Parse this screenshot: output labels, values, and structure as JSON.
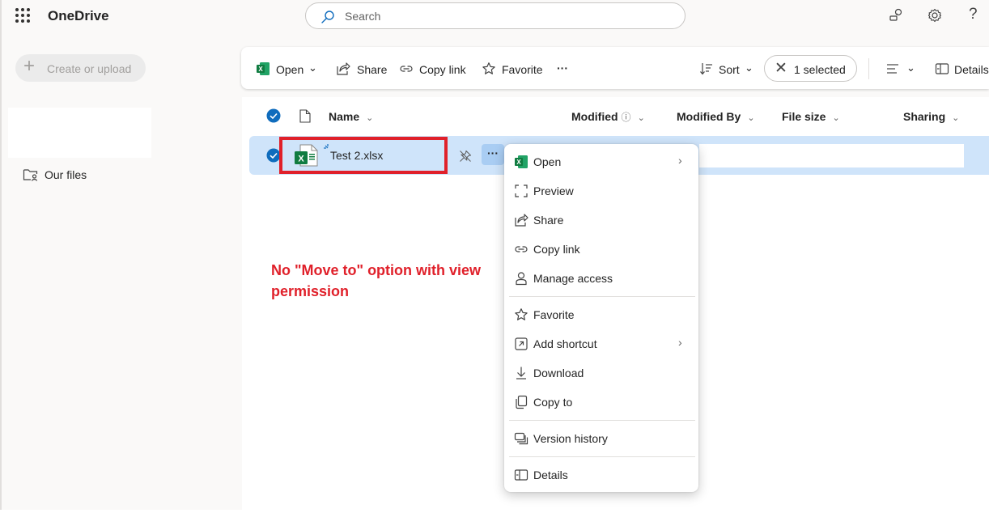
{
  "app": {
    "title": "OneDrive"
  },
  "search": {
    "placeholder": "Search"
  },
  "nav": {
    "create_label": "Create or upload",
    "items": [
      {
        "label": "Our files",
        "icon": "folder-person-icon"
      }
    ]
  },
  "commandbar": {
    "open": "Open",
    "share": "Share",
    "copy_link": "Copy link",
    "favorite": "Favorite",
    "more": "···",
    "sort": "Sort",
    "selected": "1 selected",
    "details": "Details"
  },
  "columns": {
    "name": "Name",
    "modified": "Modified",
    "modified_by": "Modified By",
    "file_size": "File size",
    "sharing": "Sharing"
  },
  "file": {
    "name": "Test 2.xlsx",
    "icon": "excel-file-icon"
  },
  "annotation": {
    "text": "No \"Move to\" option with view permission",
    "color": "#e0202a"
  },
  "context_menu": {
    "items": [
      {
        "label": "Open",
        "icon": "excel-icon",
        "submenu": true
      },
      {
        "label": "Preview",
        "icon": "preview-icon"
      },
      {
        "label": "Share",
        "icon": "share-icon"
      },
      {
        "label": "Copy link",
        "icon": "link-icon"
      },
      {
        "label": "Manage access",
        "icon": "person-icon"
      },
      {
        "label": "Favorite",
        "icon": "star-icon"
      },
      {
        "label": "Add shortcut",
        "icon": "shortcut-icon",
        "submenu": true
      },
      {
        "label": "Download",
        "icon": "download-icon"
      },
      {
        "label": "Copy to",
        "icon": "copy-icon"
      },
      {
        "label": "Version history",
        "icon": "version-history-icon"
      },
      {
        "label": "Details",
        "icon": "details-icon"
      }
    ]
  },
  "colors": {
    "accent": "#0f6cbd",
    "selection": "#cfe4fa",
    "excel": "#107c41"
  }
}
